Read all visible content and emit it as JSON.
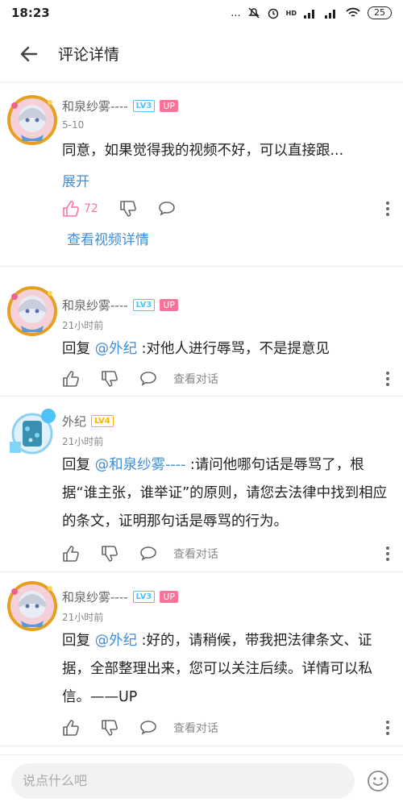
{
  "status_bar": {
    "time": "18:23",
    "dots": "...",
    "battery": "25",
    "hd_label": "HD"
  },
  "header": {
    "title": "评论详情"
  },
  "main_comment": {
    "username": "和泉纱雾----",
    "level": "LV3",
    "up_badge": "UP",
    "time": "5-10",
    "text": "同意，如果觉得我的视频不好，可以直接跟...",
    "expand_label": "展开",
    "like_count": "72",
    "view_video_label": "查看视频详情"
  },
  "replies": [
    {
      "username": "和泉纱雾----",
      "level": "LV3",
      "up_badge": "UP",
      "time": "21小时前",
      "reply_prefix": "回复 ",
      "mention": "@外纪",
      "text": " :对他人进行辱骂，不是提意见",
      "view_convo": "查看对话"
    },
    {
      "username": "外纪",
      "level": "LV4",
      "time": "21小时前",
      "reply_prefix": "回复 ",
      "mention": "@和泉纱雾----",
      "text": " :请问他哪句话是辱骂了，根据“谁主张，谁举证”的原则，请您去法律中找到相应的条文，证明那句话是辱骂的行为。",
      "view_convo": "查看对话"
    },
    {
      "username": "和泉纱雾----",
      "level": "LV3",
      "up_badge": "UP",
      "time": "21小时前",
      "reply_prefix": "回复 ",
      "mention": "@外纪",
      "text": " :好的，请稍候，带我把法律条文、证据，全部整理出来，您可以关注后续。详情可以私信。——UP",
      "view_convo": "查看对话"
    }
  ],
  "input": {
    "placeholder": "说点什么吧"
  },
  "colors": {
    "accent_blue": "#3f8fd8",
    "pink": "#fb7299",
    "level_blue": "#4fc3f7",
    "level_orange": "#f7b500"
  },
  "icons": [
    "back-arrow-icon",
    "thumb-up-icon",
    "thumb-down-icon",
    "comment-bubble-icon",
    "more-vertical-icon",
    "emoji-icon",
    "wifi-icon",
    "signal-icon",
    "alarm-icon",
    "mute-icon"
  ]
}
